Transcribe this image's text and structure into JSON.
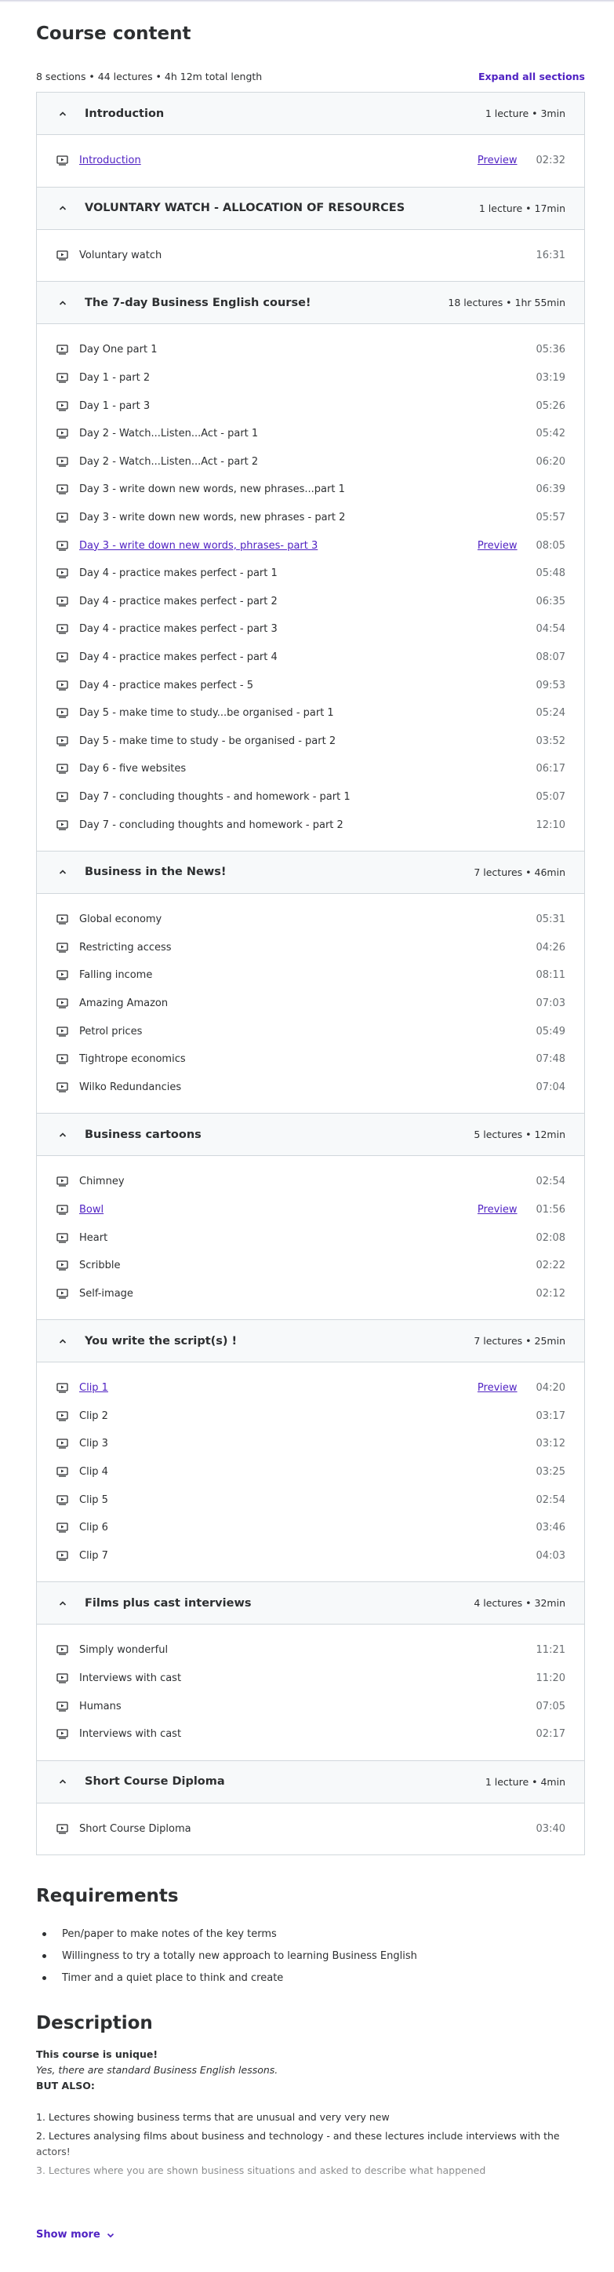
{
  "course_content": {
    "title": "Course content",
    "summary": "8 sections • 44 lectures • 4h 12m total length",
    "expand_all_label": "Expand all sections",
    "preview_label": "Preview",
    "sections": [
      {
        "title": "Introduction",
        "meta": "1 lecture • 3min",
        "lectures": [
          {
            "title": "Introduction",
            "duration": "02:32",
            "preview": true
          }
        ]
      },
      {
        "title": "VOLUNTARY WATCH - ALLOCATION OF RESOURCES",
        "meta": "1 lecture • 17min",
        "lectures": [
          {
            "title": "Voluntary watch",
            "duration": "16:31",
            "preview": false
          }
        ]
      },
      {
        "title": "The 7-day Business English course!",
        "meta": "18 lectures • 1hr 55min",
        "lectures": [
          {
            "title": "Day One part 1",
            "duration": "05:36",
            "preview": false
          },
          {
            "title": "Day 1 - part 2",
            "duration": "03:19",
            "preview": false
          },
          {
            "title": "Day 1 - part 3",
            "duration": "05:26",
            "preview": false
          },
          {
            "title": "Day 2 - Watch...Listen...Act - part 1",
            "duration": "05:42",
            "preview": false
          },
          {
            "title": "Day 2 - Watch...Listen...Act - part 2",
            "duration": "06:20",
            "preview": false
          },
          {
            "title": "Day 3 - write down new words, new phrases...part 1",
            "duration": "06:39",
            "preview": false
          },
          {
            "title": "Day 3 - write down new words, new phrases - part 2",
            "duration": "05:57",
            "preview": false
          },
          {
            "title": "Day 3 - write down new words, phrases- part 3",
            "duration": "08:05",
            "preview": true
          },
          {
            "title": "Day 4 - practice makes perfect - part 1",
            "duration": "05:48",
            "preview": false
          },
          {
            "title": "Day 4 - practice makes perfect - part 2",
            "duration": "06:35",
            "preview": false
          },
          {
            "title": "Day 4 - practice makes perfect - part 3",
            "duration": "04:54",
            "preview": false
          },
          {
            "title": "Day 4 - practice makes perfect - part 4",
            "duration": "08:07",
            "preview": false
          },
          {
            "title": "Day 4 - practice makes perfect - 5",
            "duration": "09:53",
            "preview": false
          },
          {
            "title": "Day 5 - make time to study...be organised - part 1",
            "duration": "05:24",
            "preview": false
          },
          {
            "title": "Day 5 - make time to study - be organised - part 2",
            "duration": "03:52",
            "preview": false
          },
          {
            "title": "Day 6 - five websites",
            "duration": "06:17",
            "preview": false
          },
          {
            "title": "Day 7 - concluding thoughts - and homework - part 1",
            "duration": "05:07",
            "preview": false
          },
          {
            "title": "Day 7 - concluding thoughts and homework - part 2",
            "duration": "12:10",
            "preview": false
          }
        ]
      },
      {
        "title": "Business in the News!",
        "meta": "7 lectures • 46min",
        "lectures": [
          {
            "title": "Global economy",
            "duration": "05:31",
            "preview": false
          },
          {
            "title": "Restricting access",
            "duration": "04:26",
            "preview": false
          },
          {
            "title": "Falling income",
            "duration": "08:11",
            "preview": false
          },
          {
            "title": "Amazing Amazon",
            "duration": "07:03",
            "preview": false
          },
          {
            "title": "Petrol prices",
            "duration": "05:49",
            "preview": false
          },
          {
            "title": "Tightrope economics",
            "duration": "07:48",
            "preview": false
          },
          {
            "title": "Wilko Redundancies",
            "duration": "07:04",
            "preview": false
          }
        ]
      },
      {
        "title": "Business cartoons",
        "meta": "5 lectures • 12min",
        "lectures": [
          {
            "title": "Chimney",
            "duration": "02:54",
            "preview": false
          },
          {
            "title": "Bowl",
            "duration": "01:56",
            "preview": true
          },
          {
            "title": "Heart",
            "duration": "02:08",
            "preview": false
          },
          {
            "title": "Scribble",
            "duration": "02:22",
            "preview": false
          },
          {
            "title": "Self-image",
            "duration": "02:12",
            "preview": false
          }
        ]
      },
      {
        "title": "You write the script(s) !",
        "meta": "7 lectures • 25min",
        "lectures": [
          {
            "title": "Clip 1",
            "duration": "04:20",
            "preview": true
          },
          {
            "title": "Clip 2",
            "duration": "03:17",
            "preview": false
          },
          {
            "title": "Clip 3",
            "duration": "03:12",
            "preview": false
          },
          {
            "title": "Clip 4",
            "duration": "03:25",
            "preview": false
          },
          {
            "title": "Clip 5",
            "duration": "02:54",
            "preview": false
          },
          {
            "title": "Clip 6",
            "duration": "03:46",
            "preview": false
          },
          {
            "title": "Clip 7",
            "duration": "04:03",
            "preview": false
          }
        ]
      },
      {
        "title": "Films plus cast interviews",
        "meta": "4 lectures • 32min",
        "lectures": [
          {
            "title": "Simply wonderful",
            "duration": "11:21",
            "preview": false
          },
          {
            "title": "Interviews with cast",
            "duration": "11:20",
            "preview": false
          },
          {
            "title": "Humans",
            "duration": "07:05",
            "preview": false
          },
          {
            "title": "Interviews with cast",
            "duration": "02:17",
            "preview": false
          }
        ]
      },
      {
        "title": "Short Course Diploma",
        "meta": "1 lecture • 4min",
        "lectures": [
          {
            "title": "Short Course Diploma",
            "duration": "03:40",
            "preview": false
          }
        ]
      }
    ]
  },
  "requirements": {
    "title": "Requirements",
    "items": [
      "Pen/paper to make notes of the key terms",
      "Willingness to try a totally new approach to learning Business English",
      "Timer and a quiet place to think and create"
    ]
  },
  "description": {
    "title": "Description",
    "line1": "This course is unique!",
    "line2": "Yes, there are standard Business English lessons.",
    "line3": "BUT ALSO:",
    "point1": "1. Lectures showing business terms that are unusual and very very new",
    "point2": "2. Lectures analysing films about business and technology - and these lectures include interviews with the actors!",
    "point3": "3. Lectures where you are shown business situations and asked to describe what happened",
    "show_more_label": "Show more"
  },
  "colors": {
    "accent": "#5022c3",
    "text": "#2d2f31",
    "muted": "#6a6f73",
    "border": "#d1d7dc",
    "header_bg": "#f7f9fa"
  }
}
